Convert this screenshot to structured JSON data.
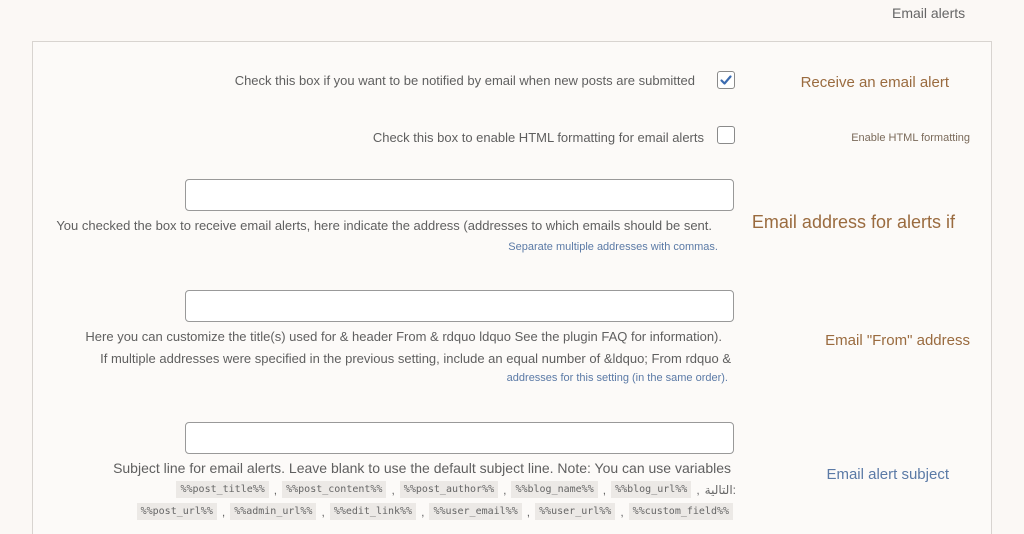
{
  "section_title": "Email alerts",
  "rows": {
    "receive": {
      "label": "Receive an email alert",
      "description": "Check this box if you want to be notified by email when new posts are submitted",
      "checked": true
    },
    "html": {
      "label": "Enable HTML formatting",
      "description": "Check this box to enable HTML formatting for email alerts",
      "checked": false
    },
    "address": {
      "label": "Email address for alerts if",
      "description": "You checked the box to receive email alerts, here indicate the address (addresses to which emails should be sent.",
      "hint": "Separate multiple addresses with commas.",
      "value": ""
    },
    "from": {
      "label": "Email \"From\" address",
      "description_1": "Here you can customize the title(s) used for & header From & rdquo ldquo See the plugin FAQ for information).",
      "description_2": "If multiple addresses were specified in the previous setting, include an equal number of &ldquo; From rdquo &",
      "hint": "addresses for this setting (in the same order).",
      "value": ""
    },
    "subject": {
      "label": "Email alert subject",
      "description": "Subject line for email alerts. Leave blank to use the default subject line. Note: You can use variables",
      "value": "",
      "variables_row1": [
        "%%post_title%%",
        "%%post_content%%",
        "%%post_author%%",
        "%%blog_name%%",
        "%%blog_url%%"
      ],
      "variables_row1_suffix": "التالية:",
      "variables_row2": [
        "%%post_url%%",
        "%%admin_url%%",
        "%%edit_link%%",
        "%%user_email%%",
        "%%user_url%%",
        "%%custom_field%%"
      ]
    }
  },
  "colors": {
    "label_brown": "#9a6b3f",
    "hint_blue": "#5b7aa6",
    "checkbox_check": "#3b6bb0"
  },
  "icons": {
    "receive_checkbox": "checkmark-icon"
  }
}
